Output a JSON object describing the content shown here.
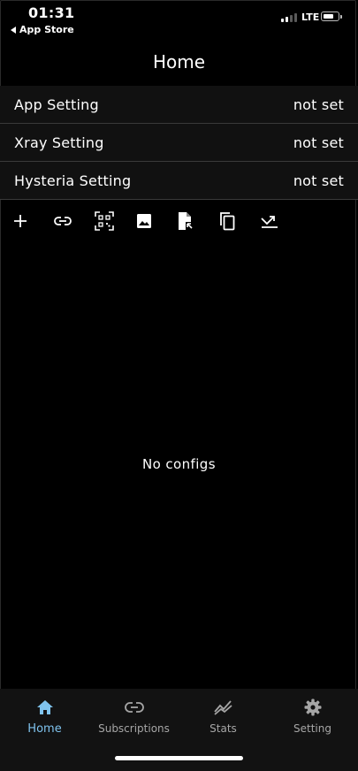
{
  "status_bar": {
    "time": "01:31",
    "back_label": "App Store",
    "network": "LTE"
  },
  "header": {
    "title": "Home"
  },
  "settings": [
    {
      "label": "App Setting",
      "value": "not set"
    },
    {
      "label": "Xray Setting",
      "value": "not set"
    },
    {
      "label": "Hysteria Setting",
      "value": "not set"
    }
  ],
  "toolbar": {
    "icons": [
      "add-icon",
      "link-icon",
      "qr-scan-icon",
      "image-icon",
      "file-import-icon",
      "copy-icon",
      "download-icon"
    ]
  },
  "main": {
    "empty_message": "No configs"
  },
  "tabbar": {
    "active_color": "#7fc3ee",
    "items": [
      {
        "label": "Home",
        "icon": "home-icon",
        "active": true
      },
      {
        "label": "Subscriptions",
        "icon": "link-icon",
        "active": false
      },
      {
        "label": "Stats",
        "icon": "stats-icon",
        "active": false
      },
      {
        "label": "Setting",
        "icon": "gear-icon",
        "active": false
      }
    ]
  }
}
